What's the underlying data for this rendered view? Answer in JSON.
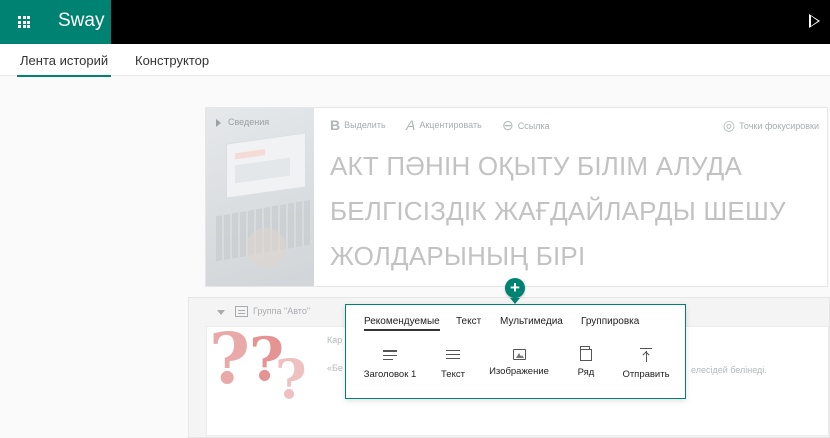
{
  "app": {
    "title": "Sway"
  },
  "tabs": [
    {
      "label": "Лента историй",
      "active": true
    },
    {
      "label": "Конструктор",
      "active": false
    }
  ],
  "card1": {
    "info_label": "Сведения",
    "toolbar": [
      {
        "icon": "bold-icon",
        "glyph": "B",
        "label": "Выделить"
      },
      {
        "icon": "accent-icon",
        "glyph": "A",
        "label": "Акцентировать"
      },
      {
        "icon": "link-icon",
        "glyph": "⊖",
        "label": "Ссылка"
      }
    ],
    "focus_points_label": "Точки фокусировки",
    "heading": "АКТ ПӘНІН ОҚЫТУ БІЛІМ АЛУДА БЕЛГІСІЗДІК ЖАҒДАЙЛАРДЫ ШЕШУ ЖОЛДАРЫНЫҢ БІРІ"
  },
  "add_button": {
    "glyph": "+"
  },
  "group": {
    "label": "Группа \"Авто\"",
    "card2_text1": "Кар",
    "card2_text2": "«Бе",
    "card2_text3": "елесідей белінеді."
  },
  "popup": {
    "tabs": [
      {
        "label": "Рекомендуемые",
        "active": true
      },
      {
        "label": "Текст",
        "active": false
      },
      {
        "label": "Мультимедиа",
        "active": false
      },
      {
        "label": "Группировка",
        "active": false
      }
    ],
    "items": [
      {
        "label": "Заголовок 1",
        "icon": "heading-icon"
      },
      {
        "label": "Текст",
        "icon": "text-icon"
      },
      {
        "label": "Изображение",
        "icon": "image-icon"
      },
      {
        "label": "Ряд",
        "icon": "row-icon"
      },
      {
        "label": "Отправить",
        "icon": "send-icon"
      }
    ]
  },
  "colors": {
    "accent": "#008272",
    "topbar": "#000000"
  }
}
